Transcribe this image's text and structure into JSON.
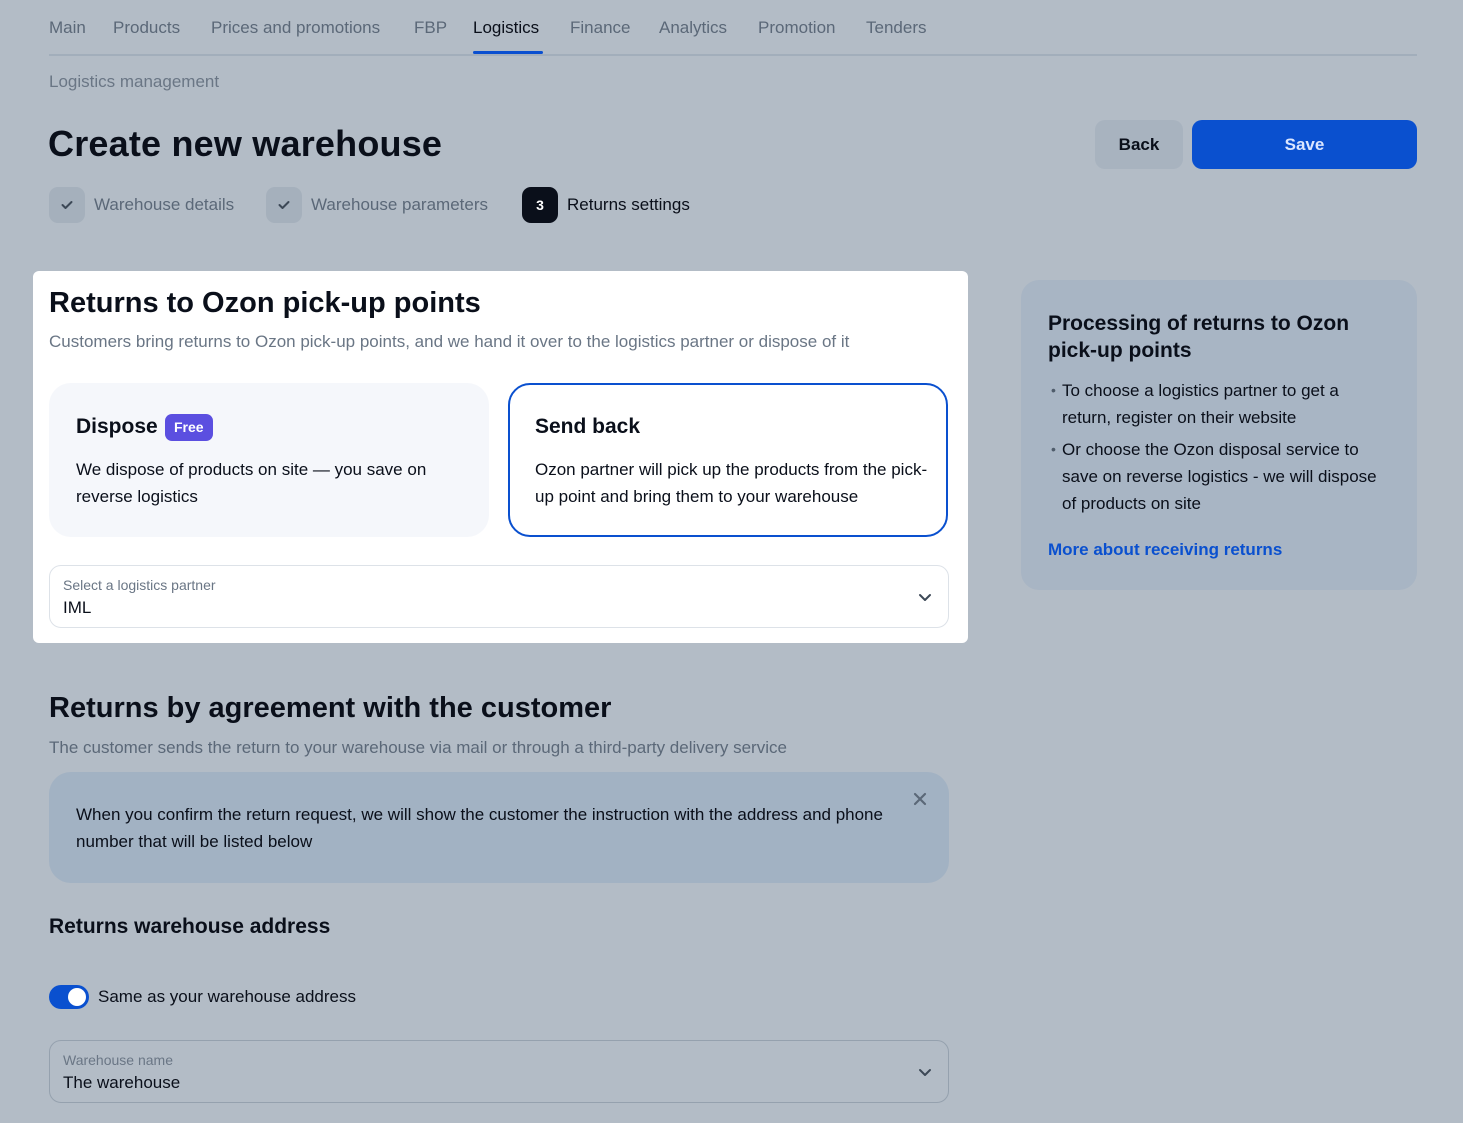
{
  "nav": {
    "items": [
      {
        "label": "Main"
      },
      {
        "label": "Products"
      },
      {
        "label": "Prices and promotions"
      },
      {
        "label": "FBP"
      },
      {
        "label": "Logistics",
        "active": true
      },
      {
        "label": "Finance"
      },
      {
        "label": "Analytics"
      },
      {
        "label": "Promotion"
      },
      {
        "label": "Tenders"
      }
    ]
  },
  "breadcrumb": "Logistics management",
  "page_title": "Create new warehouse",
  "actions": {
    "back_label": "Back",
    "save_label": "Save"
  },
  "steps": [
    {
      "label": "Warehouse details",
      "state": "done",
      "icon": "check-icon"
    },
    {
      "label": "Warehouse parameters",
      "state": "done",
      "icon": "check-icon"
    },
    {
      "number": "3",
      "label": "Returns settings",
      "state": "current"
    }
  ],
  "pickup_returns": {
    "title": "Returns to Ozon pick-up points",
    "subtitle": "Customers bring returns to Ozon pick-up points, and we hand it over to the logistics partner or dispose of it",
    "options": {
      "dispose": {
        "title": "Dispose",
        "badge": "Free",
        "description": "We dispose of products on site — you save on reverse logistics",
        "selected": false
      },
      "send_back": {
        "title": "Send back",
        "description": "Ozon partner will pick up the products from the pick-up point and bring them to your warehouse",
        "selected": true
      }
    },
    "partner_select": {
      "label": "Select a logistics partner",
      "value": "IML"
    }
  },
  "info": {
    "title": "Processing of returns to Ozon pick-up points",
    "bullets": [
      "To choose a logistics partner to get a return, register on their website",
      "Or choose the Ozon disposal service to save on reverse logistics - we will dispose of products on site"
    ],
    "link": "More about receiving returns"
  },
  "agreement_returns": {
    "title": "Returns by agreement with the customer",
    "subtitle": "The customer sends the return to your warehouse via mail or through a third-party delivery service",
    "notice": "When you confirm the return request, we will show the customer the instruction with the address and phone number that will be listed below"
  },
  "address": {
    "title": "Returns warehouse address",
    "toggle_label": "Same as your warehouse address",
    "toggle_on": true,
    "warehouse_select": {
      "label": "Warehouse name",
      "value": "The warehouse"
    }
  },
  "colors": {
    "accent": "#0a50cf",
    "badge": "#5b4fe0",
    "background": "#b3bcc6"
  }
}
